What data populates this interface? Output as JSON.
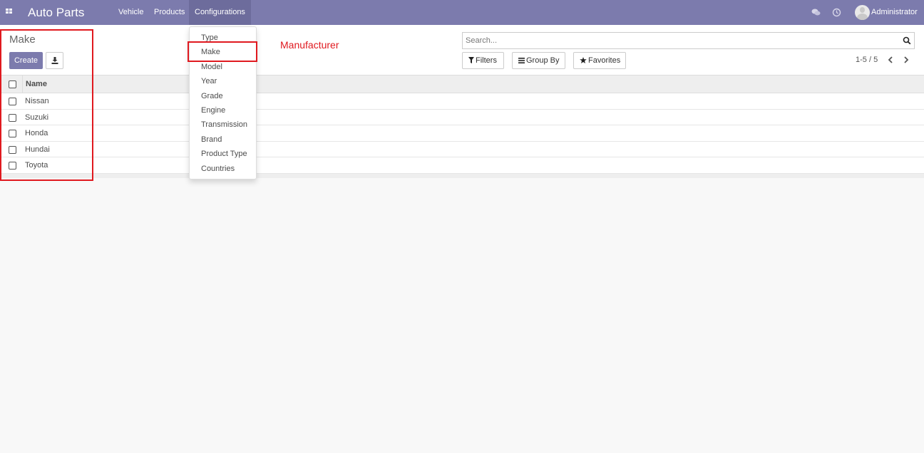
{
  "navbar": {
    "brand": "Auto Parts",
    "menu": [
      {
        "label": "Vehicle"
      },
      {
        "label": "Products"
      },
      {
        "label": "Configurations"
      }
    ],
    "user": "Administrator",
    "icons": {
      "apps": "apps-grid-icon",
      "chat": "chat-icon",
      "activity": "clock-icon",
      "avatar": "user-avatar"
    }
  },
  "control_panel": {
    "title": "Make",
    "create_label": "Create",
    "download_icon": "download-icon",
    "search_placeholder": "Search...",
    "filters_label": "Filters",
    "group_by_label": "Group By",
    "favorites_label": "Favorites",
    "pager": "1-5 / 5"
  },
  "list": {
    "column_name": "Name",
    "rows": [
      {
        "name": "Nissan"
      },
      {
        "name": "Suzuki"
      },
      {
        "name": "Honda"
      },
      {
        "name": "Hundai"
      },
      {
        "name": "Toyota"
      }
    ]
  },
  "dropdown": {
    "items": [
      {
        "label": "Type"
      },
      {
        "label": "Make"
      },
      {
        "label": "Model"
      },
      {
        "label": "Year"
      },
      {
        "label": "Grade"
      },
      {
        "label": "Engine"
      },
      {
        "label": "Transmission"
      },
      {
        "label": "Brand"
      },
      {
        "label": "Product Type"
      },
      {
        "label": "Countries"
      }
    ]
  },
  "annotation": {
    "label": "Manufacturer",
    "color": "#e0191f"
  },
  "colors": {
    "navbar": "#7c7bad",
    "primary_button": "#7c7bad"
  }
}
